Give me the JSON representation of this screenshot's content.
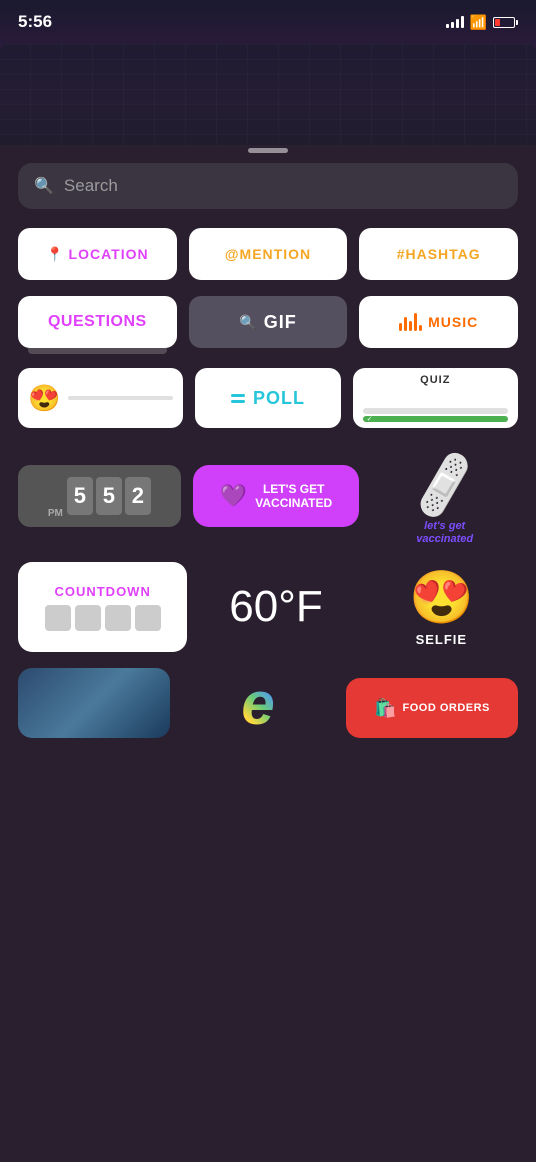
{
  "statusBar": {
    "time": "5:56",
    "signal": "signal-bars",
    "wifi": "wifi-icon",
    "battery": "battery-icon"
  },
  "searchBar": {
    "placeholder": "Search"
  },
  "stickers": {
    "row1": [
      {
        "id": "location",
        "label": "LOCATION",
        "icon": "📍",
        "color": "#e040fb"
      },
      {
        "id": "mention",
        "label": "@MENTION",
        "color": "#f5a623"
      },
      {
        "id": "hashtag",
        "label": "#HASHTAG",
        "color": "#f5a623"
      }
    ],
    "row2": [
      {
        "id": "questions",
        "label": "QUESTIONS",
        "color": "#e040fb"
      },
      {
        "id": "gif",
        "label": "GIF",
        "color": "white"
      },
      {
        "id": "music",
        "label": "MUSIC",
        "color": "#ff6b00"
      }
    ],
    "row3": [
      {
        "id": "emoji-slider",
        "emoji": "😍"
      },
      {
        "id": "poll",
        "label": "POLL",
        "color": "#26c6da"
      },
      {
        "id": "quiz",
        "label": "QUIZ",
        "color": "#333"
      }
    ],
    "row4": [
      {
        "id": "clock",
        "digits": [
          "5",
          "5",
          "2"
        ],
        "period": "PM"
      },
      {
        "id": "vaccinated",
        "text": "LET'S GET\nVACCINATED"
      },
      {
        "id": "bandaid",
        "text": "let's get\nvaccinated"
      }
    ],
    "row5": [
      {
        "id": "countdown",
        "title": "COUNTDOWN"
      },
      {
        "id": "temperature",
        "value": "60°F"
      },
      {
        "id": "selfie",
        "label": "SELFIE",
        "emoji": "😍"
      }
    ],
    "row6": [
      {
        "id": "city"
      },
      {
        "id": "rainbow-e"
      },
      {
        "id": "food-orders",
        "label": "FOOD ORDERS"
      }
    ]
  }
}
